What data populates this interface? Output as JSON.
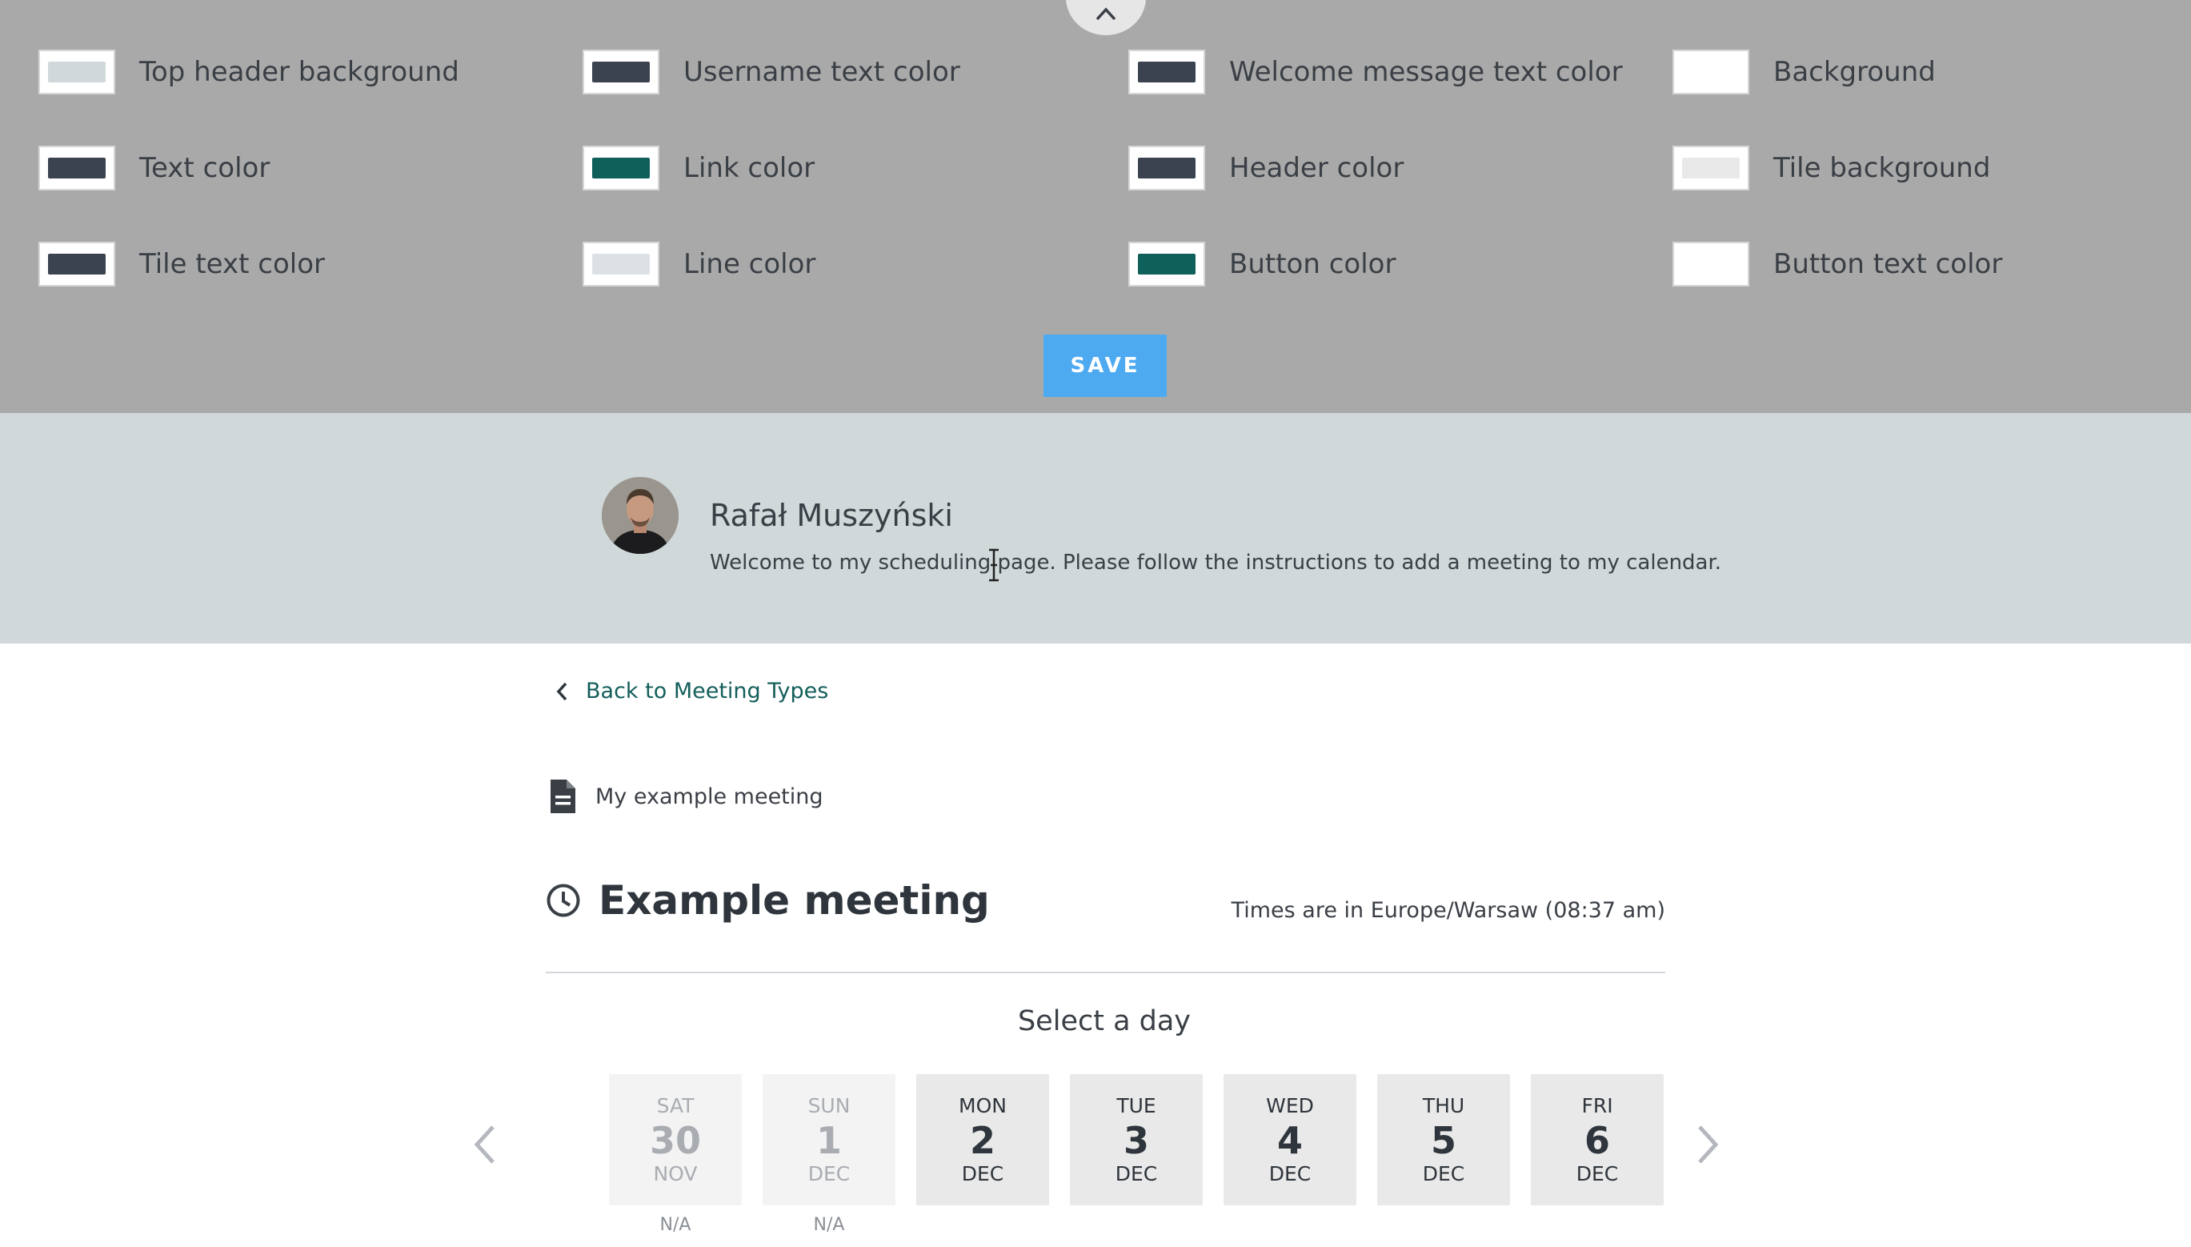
{
  "customize": {
    "collapse_icon": "chevron-up-icon",
    "save_label": "SAVE",
    "options": [
      {
        "label": "Top header background",
        "color": "#d0d8d9"
      },
      {
        "label": "Username text color",
        "color": "#3b4350"
      },
      {
        "label": "Welcome message text color",
        "color": "#3b4350"
      },
      {
        "label": "Background",
        "color": "#ffffff"
      },
      {
        "label": "Text color",
        "color": "#3b4350"
      },
      {
        "label": "Link color",
        "color": "#0f5f5b"
      },
      {
        "label": "Header color",
        "color": "#3b4350"
      },
      {
        "label": "Tile background",
        "color": "#e9e9e9"
      },
      {
        "label": "Tile text color",
        "color": "#3b4350"
      },
      {
        "label": "Line color",
        "color": "#dde1e6"
      },
      {
        "label": "Button color",
        "color": "#0f5f5b"
      },
      {
        "label": "Button text color",
        "color": "#ffffff"
      }
    ]
  },
  "profile": {
    "name": "Rafał Muszyński",
    "welcome": "Welcome to my scheduling page. Please follow the instructions to add a meeting to my calendar."
  },
  "main": {
    "back_link": "Back to Meeting Types",
    "meeting_type": "My example meeting",
    "meeting_title": "Example meeting",
    "timezone_text": "Times are in Europe/Warsaw (08:37 am)",
    "select_day_label": "Select a day",
    "days": [
      {
        "dow": "SAT",
        "num": "30",
        "month": "NOV",
        "status": "N/A",
        "available": false
      },
      {
        "dow": "SUN",
        "num": "1",
        "month": "DEC",
        "status": "N/A",
        "available": false
      },
      {
        "dow": "MON",
        "num": "2",
        "month": "DEC",
        "status": "",
        "available": true
      },
      {
        "dow": "TUE",
        "num": "3",
        "month": "DEC",
        "status": "",
        "available": true
      },
      {
        "dow": "WED",
        "num": "4",
        "month": "DEC",
        "status": "",
        "available": true
      },
      {
        "dow": "THU",
        "num": "5",
        "month": "DEC",
        "status": "",
        "available": true
      },
      {
        "dow": "FRI",
        "num": "6",
        "month": "DEC",
        "status": "",
        "available": true
      }
    ]
  }
}
